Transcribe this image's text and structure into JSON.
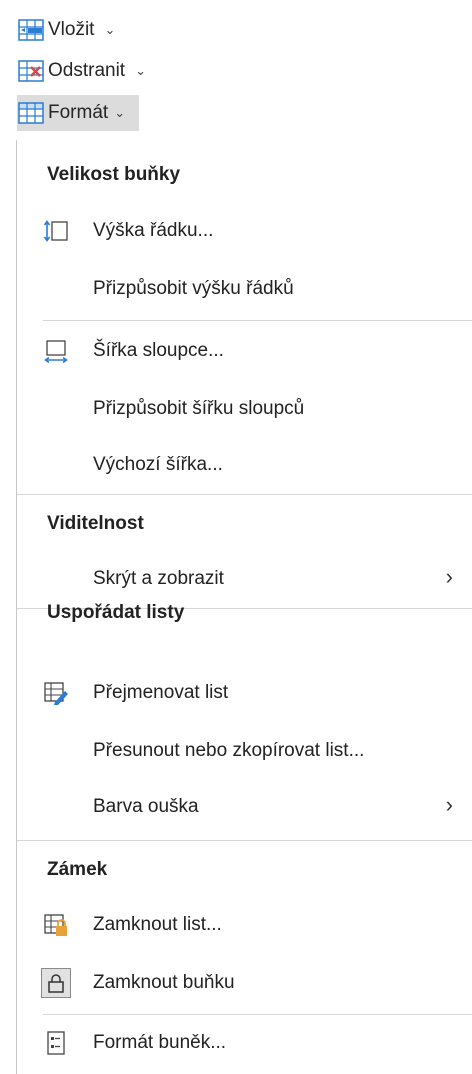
{
  "ribbon": {
    "insert_label": "Vložit",
    "delete_label": "Odstranit",
    "format_label": "Formát"
  },
  "menu": {
    "sections": {
      "cell_size": "Velikost buňky",
      "visibility": "Viditelnost",
      "organize_sheets": "Uspořádat listy",
      "lock": "Zámek"
    },
    "items": {
      "row_height": "Výška řádku...",
      "autofit_row_height": "Přizpůsobit výšku řádků",
      "column_width": "Šířka sloupce...",
      "autofit_column_width": "Přizpůsobit šířku sloupců",
      "default_width": "Výchozí šířka...",
      "hide_unhide": "Skrýt a zobrazit",
      "rename_sheet": "Přejmenovat list",
      "move_copy_sheet": "Přesunout nebo zkopírovat list...",
      "tab_color": "Barva ouška",
      "protect_sheet": "Zamknout list...",
      "lock_cell": "Zamknout buňku",
      "format_cells": "Formát buněk..."
    }
  },
  "colors": {
    "accent_blue": "#2b7cd3",
    "accent_red": "#e0443a",
    "accent_orange": "#e8a23a"
  }
}
